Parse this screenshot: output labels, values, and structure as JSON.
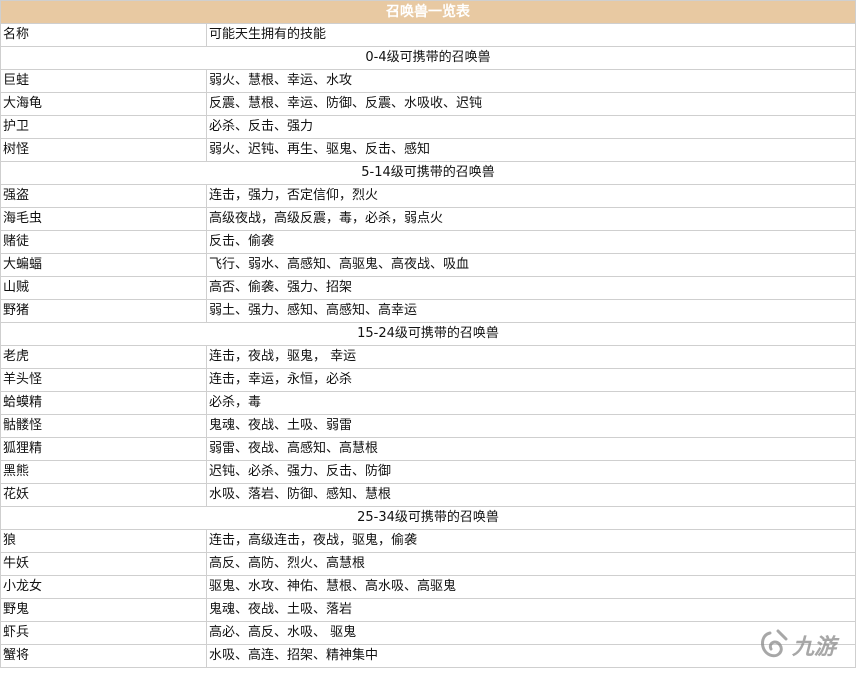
{
  "title": "召唤兽一览表",
  "header": {
    "col1": "名称",
    "col2": "可能天生拥有的技能"
  },
  "groups": [
    {
      "section": "0-4级可携带的召唤兽",
      "rows": [
        {
          "name": "巨蛙",
          "skills": "弱火、慧根、幸运、水攻"
        },
        {
          "name": "大海龟",
          "skills": "反震、慧根、幸运、防御、反震、水吸收、迟钝"
        },
        {
          "name": "护卫",
          "skills": "必杀、反击、强力"
        },
        {
          "name": "树怪",
          "skills": "弱火、迟钝、再生、驱鬼、反击、感知"
        }
      ]
    },
    {
      "section": "5-14级可携带的召唤兽",
      "rows": [
        {
          "name": "强盗",
          "skills": "连击，强力，否定信仰，烈火"
        },
        {
          "name": "海毛虫",
          "skills": "高级夜战，高级反震，毒，必杀，弱点火"
        },
        {
          "name": "赌徒",
          "skills": "反击、偷袭"
        },
        {
          "name": "大蝙蝠",
          "skills": "飞行、弱水、高感知、高驱鬼、高夜战、吸血"
        },
        {
          "name": "山贼",
          "skills": "高否、偷袭、强力、招架"
        },
        {
          "name": "野猪",
          "skills": "弱土、强力、感知、高感知、高幸运"
        }
      ]
    },
    {
      "section": "15-24级可携带的召唤兽",
      "rows": [
        {
          "name": "老虎",
          "skills": "连击，夜战，驱鬼， 幸运"
        },
        {
          "name": "羊头怪",
          "skills": "连击，幸运，永恒，必杀"
        },
        {
          "name": "蛤蟆精",
          "skills": "必杀，毒"
        },
        {
          "name": "骷髅怪",
          "skills": "鬼魂、夜战、土吸、弱雷"
        },
        {
          "name": "狐狸精",
          "skills": "弱雷、夜战、高感知、高慧根"
        },
        {
          "name": "黑熊",
          "skills": "迟钝、必杀、强力、反击、防御"
        },
        {
          "name": "花妖",
          "skills": "水吸、落岩、防御、感知、慧根"
        }
      ]
    },
    {
      "section": "25-34级可携带的召唤兽",
      "rows": [
        {
          "name": "狼",
          "skills": "连击，高级连击，夜战，驱鬼，偷袭"
        },
        {
          "name": "牛妖",
          "skills": "高反、高防、烈火、高慧根"
        },
        {
          "name": "小龙女",
          "skills": "驱鬼、水攻、神佑、慧根、高水吸、高驱鬼"
        },
        {
          "name": "野鬼",
          "skills": "鬼魂、夜战、土吸、落岩"
        },
        {
          "name": "虾兵",
          "skills": "高必、高反、水吸、 驱鬼"
        },
        {
          "name": "蟹将",
          "skills": "水吸、高连、招架、精神集中"
        }
      ]
    }
  ],
  "watermark": {
    "text": "九游",
    "icon": "jiuyou-logo-icon",
    "color": "#8a8a8a"
  }
}
